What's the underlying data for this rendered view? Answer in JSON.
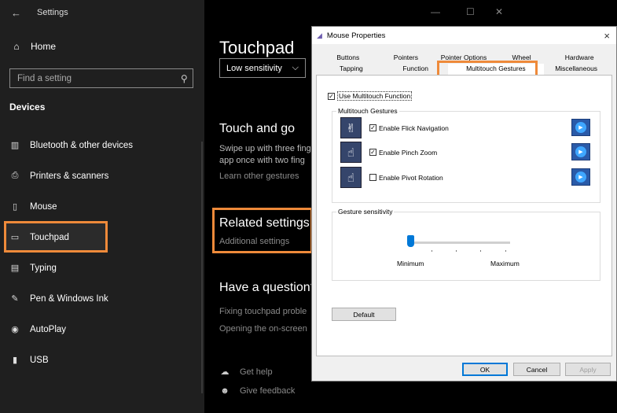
{
  "sidebar": {
    "back_icon": "arrow-left-icon",
    "app_title": "Settings",
    "home_label": "Home",
    "search_placeholder": "Find a setting",
    "section_label": "Devices",
    "items": [
      {
        "label": "Bluetooth & other devices",
        "icon": "bluetooth-icon"
      },
      {
        "label": "Printers & scanners",
        "icon": "printer-icon"
      },
      {
        "label": "Mouse",
        "icon": "mouse-icon"
      },
      {
        "label": "Touchpad",
        "icon": "touchpad-icon"
      },
      {
        "label": "Typing",
        "icon": "keyboard-icon"
      },
      {
        "label": "Pen & Windows Ink",
        "icon": "pen-icon"
      },
      {
        "label": "AutoPlay",
        "icon": "autoplay-icon"
      },
      {
        "label": "USB",
        "icon": "usb-icon"
      }
    ],
    "highlight_color": "#ee8a3a"
  },
  "main": {
    "title": "Touchpad",
    "sensitivity_value": "Low sensitivity",
    "touch_go": {
      "heading": "Touch and go",
      "desc_line1": "Swipe up with three fing",
      "desc_line2": "app once with two fing",
      "link": "Learn other gestures"
    },
    "related": {
      "heading": "Related settings",
      "link": "Additional settings"
    },
    "question": {
      "heading": "Have a question?",
      "link1": "Fixing touchpad proble",
      "link2": "Opening the on-screen"
    },
    "help": {
      "get_help": "Get help",
      "give_feedback": "Give feedback"
    }
  },
  "dialog": {
    "title": "Mouse Properties",
    "tabs_row1": [
      "Buttons",
      "Pointers",
      "Pointer Options",
      "Wheel",
      "Hardware"
    ],
    "tabs_row2": [
      "Tapping",
      "Function",
      "Multitouch Gestures",
      "Miscellaneous"
    ],
    "active_tab": "Multitouch Gestures",
    "use_multitouch": {
      "label": "Use Multitouch Function",
      "checked": true
    },
    "group_gestures": "Multitouch Gestures",
    "gestures": [
      {
        "label": "Enable Flick Navigation",
        "checked": true,
        "icon": "flick-hand-icon"
      },
      {
        "label": "Enable Pinch Zoom",
        "checked": true,
        "icon": "pinch-hand-icon"
      },
      {
        "label": "Enable Pivot Rotation",
        "checked": false,
        "icon": "pivot-hand-icon"
      }
    ],
    "group_sensitivity": "Gesture sensitivity",
    "slider_min": "Minimum",
    "slider_max": "Maximum",
    "slider_value": 0,
    "default_button": "Default",
    "ok_button": "OK",
    "cancel_button": "Cancel",
    "apply_button": "Apply"
  }
}
